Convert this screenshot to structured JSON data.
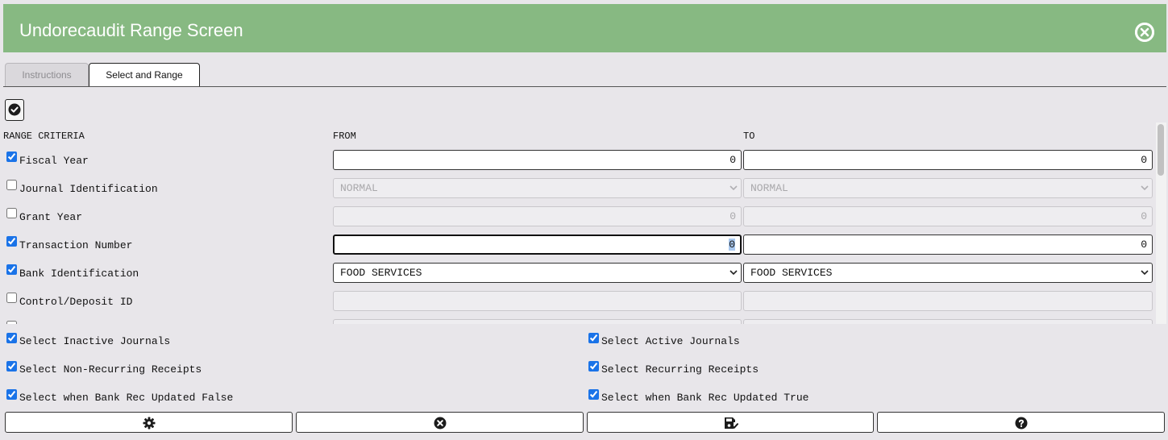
{
  "window": {
    "title": "Undorecaudit Range Screen",
    "close_icon": "close-circle-icon"
  },
  "tabs": [
    {
      "label": "Instructions",
      "active": false
    },
    {
      "label": "Select and Range",
      "active": true
    }
  ],
  "toolbar": {
    "check_all_icon": "check-circle-icon"
  },
  "range": {
    "headers": {
      "criteria": "RANGE CRITERIA",
      "from": "FROM",
      "to": "TO"
    },
    "rows": [
      {
        "label": "Fiscal Year",
        "checked": true,
        "type": "number",
        "from": "0",
        "to": "0",
        "enabled": true
      },
      {
        "label": "Journal Identification",
        "checked": false,
        "type": "select",
        "from": "NORMAL",
        "to": "NORMAL",
        "enabled": false
      },
      {
        "label": "Grant Year",
        "checked": false,
        "type": "number",
        "from": "0",
        "to": "0",
        "enabled": false
      },
      {
        "label": "Transaction Number",
        "checked": true,
        "type": "number",
        "from": "0",
        "to": "0",
        "enabled": true,
        "focused": true
      },
      {
        "label": "Bank Identification",
        "checked": true,
        "type": "select",
        "from": "FOOD SERVICES",
        "to": "FOOD SERVICES",
        "enabled": true
      },
      {
        "label": "Control/Deposit ID",
        "checked": false,
        "type": "text",
        "from": "",
        "to": "",
        "enabled": false
      }
    ]
  },
  "options": {
    "left": [
      {
        "label": "Select Inactive Journals",
        "checked": true
      },
      {
        "label": "Select Non-Recurring Receipts",
        "checked": true
      },
      {
        "label": "Select when Bank Rec Updated False",
        "checked": true
      }
    ],
    "right": [
      {
        "label": "Select Active Journals",
        "checked": true
      },
      {
        "label": "Select Recurring Receipts",
        "checked": true
      },
      {
        "label": "Select when Bank Rec Updated True",
        "checked": true
      }
    ]
  },
  "actions": [
    {
      "icon": "gear-icon"
    },
    {
      "icon": "close-circle-icon"
    },
    {
      "icon": "save-icon"
    },
    {
      "icon": "help-icon"
    }
  ]
}
